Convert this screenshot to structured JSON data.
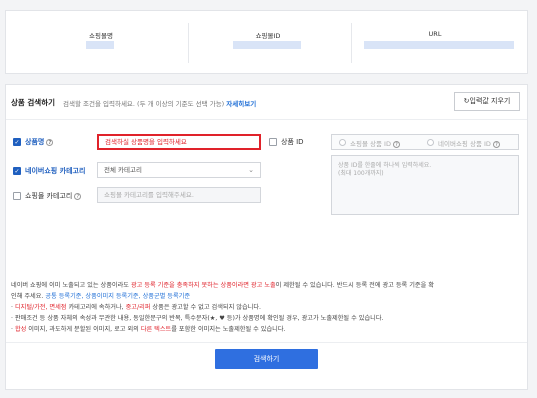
{
  "mall_info": {
    "col1_label": "쇼핑몰명",
    "col2_label": "쇼핑몰ID",
    "col3_label": "URL"
  },
  "search": {
    "title": "상품 검색하기",
    "help_text": "검색할 조건을 입력하세요. (두 개 이상의 기준도 선택 가능)",
    "help_link": "자세히보기",
    "reset_label": "입력값 지우기",
    "product_name_label": "상품명",
    "product_name_placeholder": "검색하실 상품명을 입력하세요",
    "product_id_label": "상품 ID",
    "mall_product_id_label": "쇼핑몰 상품 ID",
    "naver_product_id_label": "네이버쇼핑 상품 ID",
    "naver_category_label": "네이버쇼핑 카테고리",
    "category_select_value": "전체 카테고리",
    "mall_category_label": "쇼핑몰 카테고리",
    "mall_category_placeholder": "쇼핑몰 카테고리를 입력해주세요.",
    "id_textarea_line1": "상품 ID를 한줄에 하나씩 입력하세요.",
    "id_textarea_line2": "(최대 100개까지)",
    "search_button": "검색하기"
  },
  "notice": {
    "l1a": "네이버 쇼핑에 이미 노출되고 있는 상품이라도 ",
    "l1b": "광고 등록 기준을 충족하지 못하는 상품이라면 광고 노출",
    "l1c": "이 제한될 수 있습니다. 반드시 등록 전에 광고 등록 기준을 확",
    "l2a": "인해 주세요. ",
    "l2b": "공통 등록기준, 상품이미지 등록기준, 상품군별 등록기준",
    "l3a": "· ",
    "l3b": "디지털/가전, 면세점",
    "l3c": " 카테고리에 속하거나, ",
    "l3d": "중고/리퍼",
    "l3e": " 상품은 광고할 수 없고 검색되지 않습니다.",
    "l4": "· 판매조건 등 상품 자체의 속성과 무관한 내용, 동일한문구의 반복, 특수문자(★, ♥ 등)가 상품명에 확인될 경우, 광고가 노출제한될 수 있습니다.",
    "l5a": "· ",
    "l5b": "합성",
    "l5c": " 이미지, 과도하게 분할된 이미지, 로고 외의 ",
    "l5d": "다른 텍스트",
    "l5e": "를 포함한 이미지는 노출제한될 수 있습니다."
  }
}
